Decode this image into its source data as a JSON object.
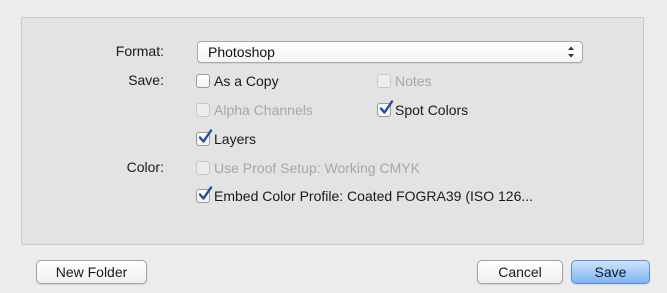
{
  "format": {
    "label": "Format:",
    "selected": "Photoshop"
  },
  "save": {
    "label": "Save:",
    "as_a_copy": {
      "label": "As a Copy",
      "checked": false,
      "enabled": true
    },
    "notes": {
      "label": "Notes",
      "checked": false,
      "enabled": false
    },
    "alpha_channels": {
      "label": "Alpha Channels",
      "checked": false,
      "enabled": false
    },
    "spot_colors": {
      "label": "Spot Colors",
      "checked": true,
      "enabled": true
    },
    "layers": {
      "label": "Layers",
      "checked": true,
      "enabled": true
    }
  },
  "color": {
    "label": "Color:",
    "use_proof_setup": {
      "label": "Use Proof Setup:  Working CMYK",
      "checked": false,
      "enabled": false
    },
    "embed_color_profile": {
      "label": "Embed Color Profile:  Coated FOGRA39 (ISO 126...",
      "checked": true,
      "enabled": true
    }
  },
  "buttons": {
    "new_folder": "New Folder",
    "cancel": "Cancel",
    "save": "Save"
  },
  "colors": {
    "check_mark": "#1f4f9a",
    "primary_button": "#7fb3ef"
  }
}
